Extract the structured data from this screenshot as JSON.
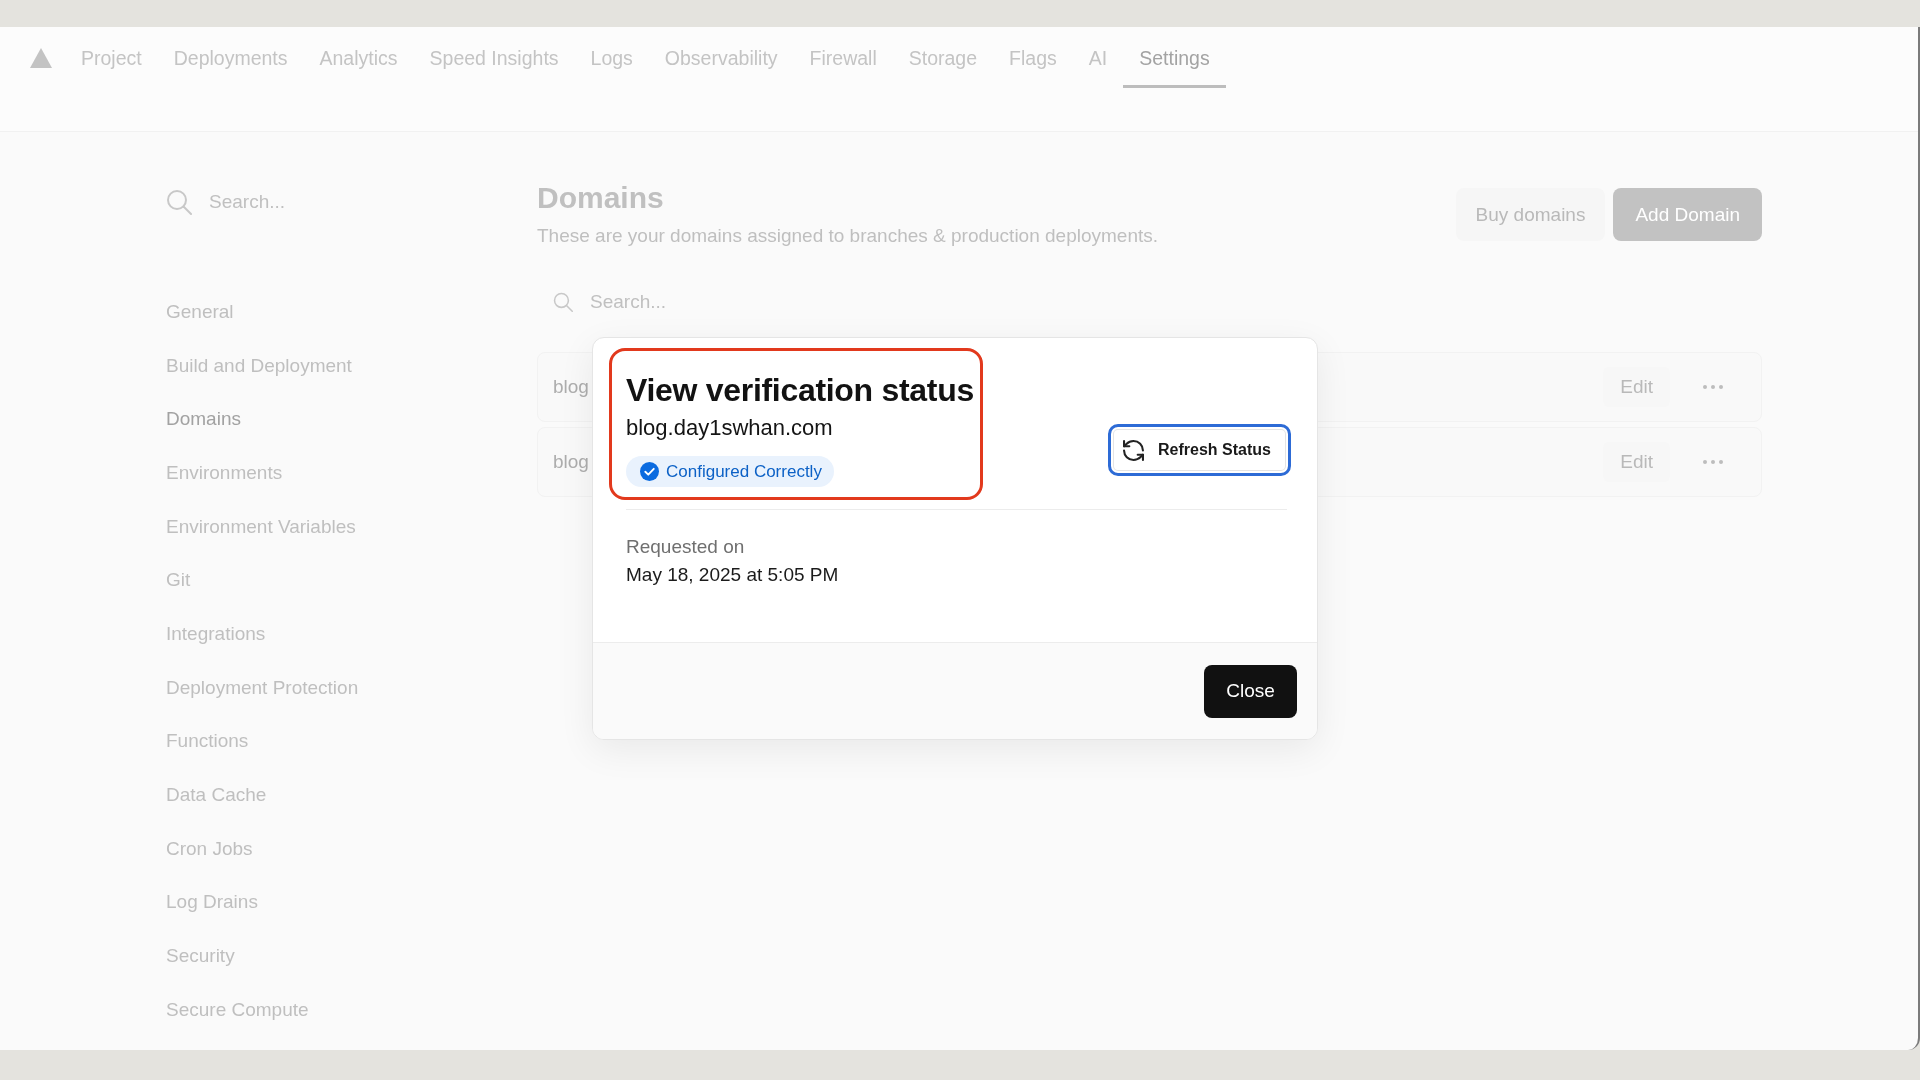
{
  "nav": {
    "tabs": [
      {
        "label": "Project",
        "selected": false
      },
      {
        "label": "Deployments",
        "selected": false
      },
      {
        "label": "Analytics",
        "selected": false
      },
      {
        "label": "Speed Insights",
        "selected": false
      },
      {
        "label": "Logs",
        "selected": false
      },
      {
        "label": "Observability",
        "selected": false
      },
      {
        "label": "Firewall",
        "selected": false
      },
      {
        "label": "Storage",
        "selected": false
      },
      {
        "label": "Flags",
        "selected": false
      },
      {
        "label": "AI",
        "selected": false
      },
      {
        "label": "Settings",
        "selected": true
      }
    ]
  },
  "sidebar": {
    "search": {
      "placeholder": "Search..."
    },
    "items": [
      {
        "label": "General",
        "selected": false
      },
      {
        "label": "Build and Deployment",
        "selected": false
      },
      {
        "label": "Domains",
        "selected": true
      },
      {
        "label": "Environments",
        "selected": false
      },
      {
        "label": "Environment Variables",
        "selected": false
      },
      {
        "label": "Git",
        "selected": false
      },
      {
        "label": "Integrations",
        "selected": false
      },
      {
        "label": "Deployment Protection",
        "selected": false
      },
      {
        "label": "Functions",
        "selected": false
      },
      {
        "label": "Data Cache",
        "selected": false
      },
      {
        "label": "Cron Jobs",
        "selected": false
      },
      {
        "label": "Log Drains",
        "selected": false
      },
      {
        "label": "Security",
        "selected": false
      },
      {
        "label": "Secure Compute",
        "selected": false
      }
    ]
  },
  "main": {
    "title": "Domains",
    "subtitle": "These are your domains assigned to branches & production deployments.",
    "actions": [
      {
        "label": "Buy domains",
        "kind": "secondary"
      },
      {
        "label": "Add Domain",
        "kind": "primary"
      }
    ],
    "search": {
      "placeholder": "Search..."
    },
    "domains": [
      {
        "name": "blog",
        "edit": "Edit"
      },
      {
        "name": "blog",
        "edit": "Edit"
      }
    ]
  },
  "dialog": {
    "title": "View verification status",
    "domain": "blog.day1swhan.com",
    "status": "Configured Correctly",
    "refresh_button": "Refresh Status",
    "requested_label": "Requested on",
    "requested_at": "May 18, 2025 at 5:05 PM",
    "close_button": "Close"
  }
}
